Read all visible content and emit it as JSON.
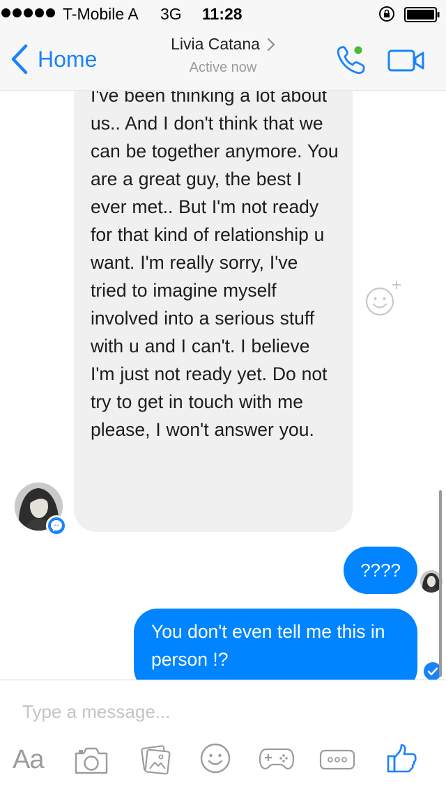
{
  "status_bar": {
    "carrier": "T-Mobile A",
    "network": "3G",
    "time": "11:28",
    "icons": [
      "signal-dots-icon",
      "orientation-lock-icon",
      "battery-icon"
    ]
  },
  "nav": {
    "back_label": "Home",
    "contact_name": "Livia Catana",
    "status": "Active now",
    "icons": [
      "back-chevron-icon",
      "phone-icon",
      "video-camera-icon"
    ],
    "accent_color": "#1a82fb",
    "online_color": "#44bd32"
  },
  "conversation": {
    "incoming": {
      "text": "I've been thinking a lot about us.. And I don't think that we can be together anymore. You are a great guy, the best I ever met.. But I'm not ready for that kind of relationship u want. I'm really sorry, I've tried to imagine myself involved into a serious stuff with u and I can't. I believe I'm just not ready yet. Do not try to get in touch with me please, I won't answer you.",
      "bubble_color": "#f1f0f0"
    },
    "outgoing": [
      {
        "text": "????"
      },
      {
        "text": "You don't even tell me this in person !?"
      }
    ],
    "outgoing_bubble_color": "#0084ff"
  },
  "composer": {
    "placeholder": "Type a message...",
    "aa_label": "Aa",
    "tools": [
      "text-format-icon",
      "camera-icon",
      "photo-gallery-icon",
      "emoji-icon",
      "game-controller-icon",
      "more-icon",
      "like-icon"
    ]
  }
}
